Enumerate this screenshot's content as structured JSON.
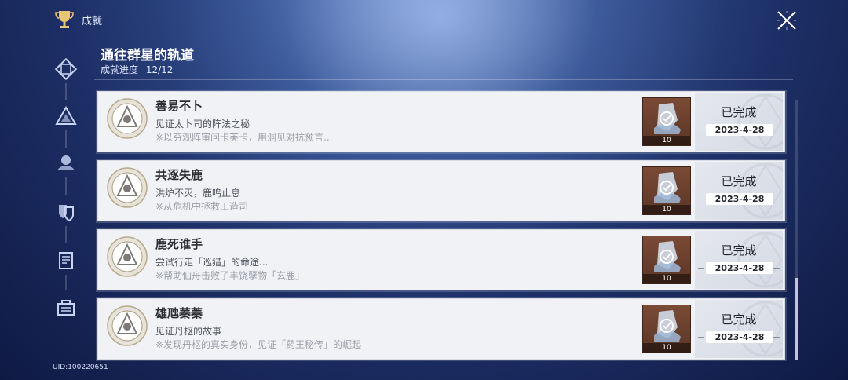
{
  "header": {
    "title": "成就"
  },
  "section": {
    "title": "通往群星的轨道",
    "progress_label": "成就进度",
    "progress_value": "12/12"
  },
  "sidebar": {
    "icons": [
      "achievement-category-1-icon",
      "achievement-category-2-icon",
      "achievement-category-3-icon",
      "achievement-category-4-icon",
      "achievement-category-5-icon",
      "achievement-category-6-icon"
    ]
  },
  "achievements": [
    {
      "name": "善易不卜",
      "desc": "见证太卜司的阵法之秘",
      "hint": "※以穷观阵审问卡芙卡，用洞见对抗预言...",
      "reward_count": "10",
      "status": "已完成",
      "date": "2023-4-28"
    },
    {
      "name": "共逐失鹿",
      "desc": "洪炉不灭，鹿鸣止息",
      "hint": "※从危机中拯救工造司",
      "reward_count": "10",
      "status": "已完成",
      "date": "2023-4-28"
    },
    {
      "name": "鹿死谁手",
      "desc": "尝试行走「巡猎」的命途...",
      "hint": "※帮助仙舟击败了丰饶孽物「玄鹿」",
      "reward_count": "10",
      "status": "已完成",
      "date": "2023-4-28"
    },
    {
      "name": "雄虺蓁蓁",
      "desc": "见证丹枢的故事",
      "hint": "※发现丹枢的真实身份，见证「药王秘传」的崛起",
      "reward_count": "10",
      "status": "已完成",
      "date": "2023-4-28"
    }
  ],
  "footer": {
    "uid": "UID:100220651"
  },
  "scroll": {
    "position_fraction": 1.0
  }
}
